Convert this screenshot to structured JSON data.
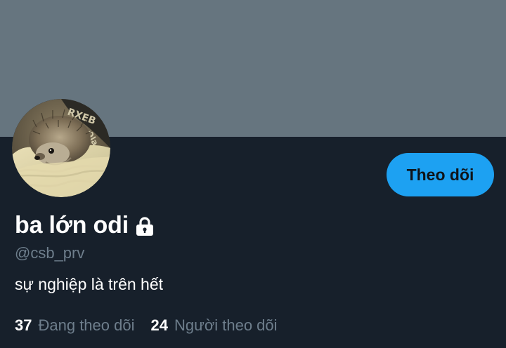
{
  "colors": {
    "banner": "#66757f",
    "background": "#17202b",
    "accent": "#1da1f2",
    "secondary_text": "#6e7e8c",
    "primary_text": "#ffffff"
  },
  "profile": {
    "display_name": "ba lớn odi",
    "protected_icon": "lock-icon",
    "handle": "@csb_prv",
    "bio": "sự nghiệp là trên hết",
    "avatar_icon": "avatar-hedgehog-photo"
  },
  "actions": {
    "follow_label": "Theo dõi"
  },
  "stats": {
    "following_count": "37",
    "following_label": "Đang theo dõi",
    "followers_count": "24",
    "followers_label": "Người theo dõi"
  }
}
